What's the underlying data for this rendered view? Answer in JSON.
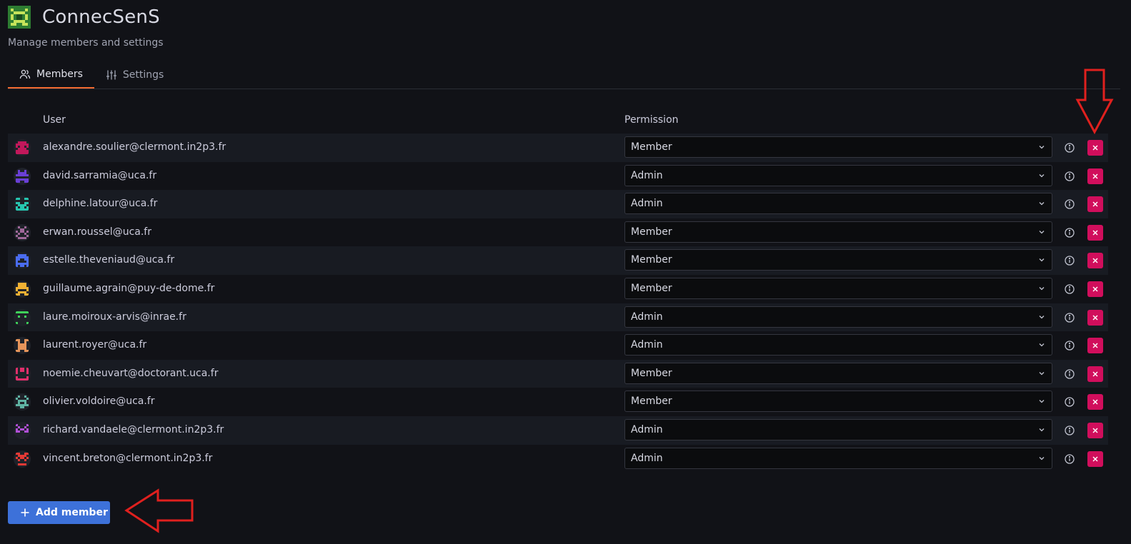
{
  "header": {
    "team_name": "ConnecSenS",
    "subtitle": "Manage members and settings"
  },
  "tabs": [
    {
      "label": "Members",
      "icon": "users-icon",
      "active": true
    },
    {
      "label": "Settings",
      "icon": "sliders-icon",
      "active": false
    }
  ],
  "table": {
    "columns": {
      "user": "User",
      "permission": "Permission"
    },
    "rows": [
      {
        "email": "alexandre.soulier@clermont.in2p3.fr",
        "permission": "Member",
        "avatar_color": "#c2185b"
      },
      {
        "email": "david.sarramia@uca.fr",
        "permission": "Admin",
        "avatar_color": "#6a3fd6"
      },
      {
        "email": "delphine.latour@uca.fr",
        "permission": "Admin",
        "avatar_color": "#26c6b0"
      },
      {
        "email": "erwan.roussel@uca.fr",
        "permission": "Member",
        "avatar_color": "#a0689a"
      },
      {
        "email": "estelle.theveniaud@uca.fr",
        "permission": "Member",
        "avatar_color": "#4a6cf0"
      },
      {
        "email": "guillaume.agrain@puy-de-dome.fr",
        "permission": "Member",
        "avatar_color": "#f2b233"
      },
      {
        "email": "laure.moiroux-arvis@inrae.fr",
        "permission": "Admin",
        "avatar_color": "#3fd15a"
      },
      {
        "email": "laurent.royer@uca.fr",
        "permission": "Admin",
        "avatar_color": "#e6945a"
      },
      {
        "email": "noemie.cheuvart@doctorant.uca.fr",
        "permission": "Member",
        "avatar_color": "#e02f6b"
      },
      {
        "email": "olivier.voldoire@uca.fr",
        "permission": "Member",
        "avatar_color": "#5fb3a3"
      },
      {
        "email": "richard.vandaele@clermont.in2p3.fr",
        "permission": "Admin",
        "avatar_color": "#b04fd6"
      },
      {
        "email": "vincent.breton@clermont.in2p3.fr",
        "permission": "Admin",
        "avatar_color": "#e53935"
      }
    ]
  },
  "actions": {
    "add_member_label": "Add member"
  },
  "colors": {
    "background": "#111217",
    "accent_tab": "#f26b31",
    "primary_button": "#3d71d9",
    "delete_button": "#d10e5c",
    "annotation_arrow": "#e0201e"
  }
}
